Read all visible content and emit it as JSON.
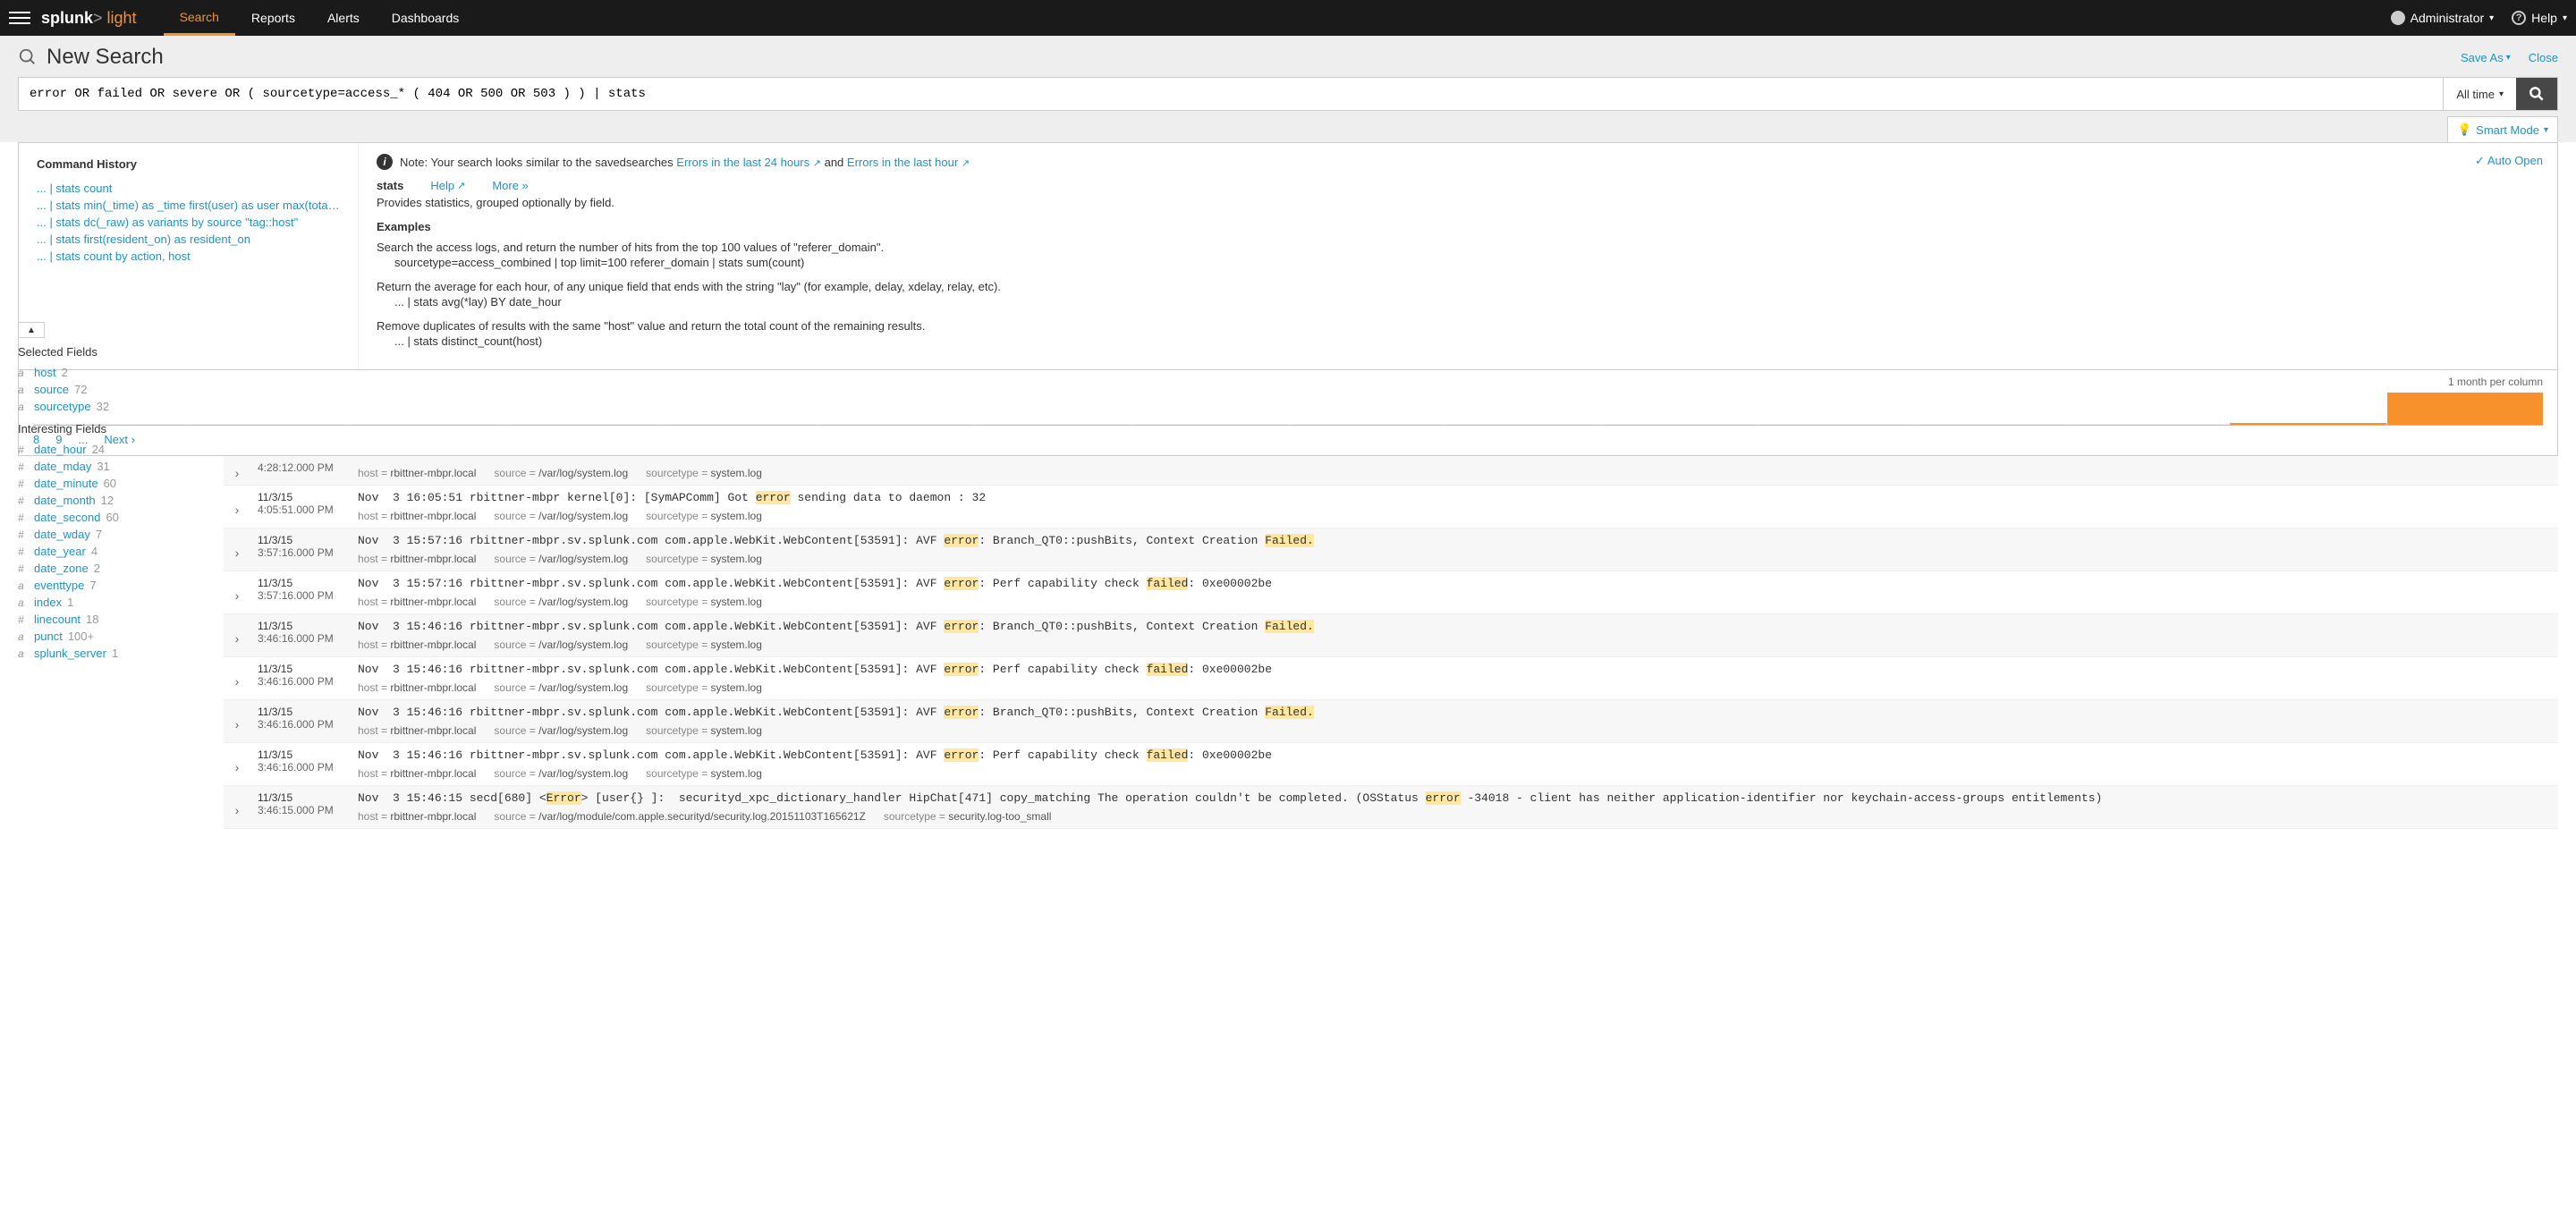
{
  "nav": {
    "brand_bold": "splunk",
    "brand_gt": ">",
    "brand_light": " light",
    "links": [
      "Search",
      "Reports",
      "Alerts",
      "Dashboards"
    ],
    "user": "Administrator",
    "help": "Help"
  },
  "search": {
    "title": "New Search",
    "save_as": "Save As",
    "close": "Close",
    "query": "error OR failed OR severe OR ( sourcetype=access_* ( 404 OR 500 OR 503 ) ) | stats",
    "time_range": "All time",
    "smart_mode": "Smart Mode"
  },
  "assist": {
    "history_title": "Command History",
    "history": [
      "... | stats count",
      "... | stats min(_time) as _time first(user) as user max(total_run_...",
      "... | stats dc(_raw) as variants by source \"tag::host\"",
      "... | stats first(resident_on) as resident_on",
      "... | stats count by action, host"
    ],
    "auto_open": "Auto Open",
    "hint_prefix": "Note: Your search looks similar to the savedsearches ",
    "hint_link1": "Errors in the last 24 hours",
    "hint_and": " and ",
    "hint_link2": "Errors in the last hour",
    "cmd": "stats",
    "help_link": "Help",
    "more_link": "More »",
    "desc": "Provides statistics, grouped optionally by field.",
    "examples_title": "Examples",
    "examples": [
      {
        "text": "Search the access logs, and return the number of hits from the top 100 values of \"referer_domain\".",
        "code": "sourcetype=access_combined | top limit=100 referer_domain | stats sum(count)"
      },
      {
        "text": "Return the average for each hour, of any unique field that ends with the string \"lay\" (for example, delay, xdelay, relay, etc).",
        "code": "... | stats avg(*lay) BY date_hour"
      },
      {
        "text": "Remove duplicates of results with the same \"host\" value and return the total count of the remaining results.",
        "code": "... | stats distinct_count(host)"
      }
    ]
  },
  "timeline": {
    "label": "1 month per column",
    "bars": [
      0,
      0,
      0,
      0,
      0,
      0,
      0,
      0,
      0,
      0,
      0,
      0,
      0,
      0,
      6,
      100
    ],
    "pager": [
      "8",
      "9",
      "...",
      "Next ›"
    ]
  },
  "fields": {
    "selected_title": "Selected Fields",
    "interesting_title": "Interesting Fields",
    "selected": [
      {
        "type": "a",
        "name": "host",
        "count": "2"
      },
      {
        "type": "a",
        "name": "source",
        "count": "72"
      },
      {
        "type": "a",
        "name": "sourcetype",
        "count": "32"
      }
    ],
    "interesting": [
      {
        "type": "#",
        "name": "date_hour",
        "count": "24"
      },
      {
        "type": "#",
        "name": "date_mday",
        "count": "31"
      },
      {
        "type": "#",
        "name": "date_minute",
        "count": "60"
      },
      {
        "type": "#",
        "name": "date_month",
        "count": "12"
      },
      {
        "type": "#",
        "name": "date_second",
        "count": "60"
      },
      {
        "type": "#",
        "name": "date_wday",
        "count": "7"
      },
      {
        "type": "#",
        "name": "date_year",
        "count": "4"
      },
      {
        "type": "#",
        "name": "date_zone",
        "count": "2"
      },
      {
        "type": "a",
        "name": "eventtype",
        "count": "7"
      },
      {
        "type": "a",
        "name": "index",
        "count": "1"
      },
      {
        "type": "#",
        "name": "linecount",
        "count": "18"
      },
      {
        "type": "a",
        "name": "punct",
        "count": "100+"
      },
      {
        "type": "a",
        "name": "splunk_server",
        "count": "1"
      }
    ]
  },
  "events": [
    {
      "date": "",
      "time": "4:28:12.000 PM",
      "raw": "",
      "host": "rbittner-mbpr.local",
      "source": "/var/log/system.log",
      "sourcetype": "system.log"
    },
    {
      "date": "11/3/15",
      "time": "4:05:51.000 PM",
      "raw_pre": "Nov  3 16:05:51 rbittner-mbpr kernel[0]: [SymAPComm] Got ",
      "raw_hl": "error",
      "raw_post": " sending data to daemon : 32",
      "host": "rbittner-mbpr.local",
      "source": "/var/log/system.log",
      "sourcetype": "system.log"
    },
    {
      "date": "11/3/15",
      "time": "3:57:16.000 PM",
      "raw_pre": "Nov  3 15:57:16 rbittner-mbpr.sv.splunk.com com.apple.WebKit.WebContent[53591]: AVF ",
      "raw_hl": "error",
      "raw_mid": ": Branch_QT0::pushBits, Context Creation ",
      "raw_hl2": "Failed.",
      "host": "rbittner-mbpr.local",
      "source": "/var/log/system.log",
      "sourcetype": "system.log"
    },
    {
      "date": "11/3/15",
      "time": "3:57:16.000 PM",
      "raw_pre": "Nov  3 15:57:16 rbittner-mbpr.sv.splunk.com com.apple.WebKit.WebContent[53591]: AVF ",
      "raw_hl": "error",
      "raw_mid": ": Perf capability check ",
      "raw_hl2": "failed",
      "raw_post": ": 0xe00002be",
      "host": "rbittner-mbpr.local",
      "source": "/var/log/system.log",
      "sourcetype": "system.log"
    },
    {
      "date": "11/3/15",
      "time": "3:46:16.000 PM",
      "raw_pre": "Nov  3 15:46:16 rbittner-mbpr.sv.splunk.com com.apple.WebKit.WebContent[53591]: AVF ",
      "raw_hl": "error",
      "raw_mid": ": Branch_QT0::pushBits, Context Creation ",
      "raw_hl2": "Failed.",
      "host": "rbittner-mbpr.local",
      "source": "/var/log/system.log",
      "sourcetype": "system.log"
    },
    {
      "date": "11/3/15",
      "time": "3:46:16.000 PM",
      "raw_pre": "Nov  3 15:46:16 rbittner-mbpr.sv.splunk.com com.apple.WebKit.WebContent[53591]: AVF ",
      "raw_hl": "error",
      "raw_mid": ": Perf capability check ",
      "raw_hl2": "failed",
      "raw_post": ": 0xe00002be",
      "host": "rbittner-mbpr.local",
      "source": "/var/log/system.log",
      "sourcetype": "system.log"
    },
    {
      "date": "11/3/15",
      "time": "3:46:16.000 PM",
      "raw_pre": "Nov  3 15:46:16 rbittner-mbpr.sv.splunk.com com.apple.WebKit.WebContent[53591]: AVF ",
      "raw_hl": "error",
      "raw_mid": ": Branch_QT0::pushBits, Context Creation ",
      "raw_hl2": "Failed.",
      "host": "rbittner-mbpr.local",
      "source": "/var/log/system.log",
      "sourcetype": "system.log"
    },
    {
      "date": "11/3/15",
      "time": "3:46:16.000 PM",
      "raw_pre": "Nov  3 15:46:16 rbittner-mbpr.sv.splunk.com com.apple.WebKit.WebContent[53591]: AVF ",
      "raw_hl": "error",
      "raw_mid": ": Perf capability check ",
      "raw_hl2": "failed",
      "raw_post": ": 0xe00002be",
      "host": "rbittner-mbpr.local",
      "source": "/var/log/system.log",
      "sourcetype": "system.log"
    },
    {
      "date": "11/3/15",
      "time": "3:46:15.000 PM",
      "raw_pre": "Nov  3 15:46:15 secd[680] <",
      "raw_hl": "Error",
      "raw_mid": "> [user{} ]:  securityd_xpc_dictionary_handler HipChat[471] copy_matching The operation couldn't be completed. (OSStatus ",
      "raw_hl2": "error",
      "raw_post": " -34018 - client has neither application-identifier nor keychain-access-groups entitlements)",
      "host": "rbittner-mbpr.local",
      "source": "/var/log/module/com.apple.securityd/security.log.20151103T165621Z",
      "sourcetype": "security.log-too_small"
    }
  ],
  "meta_labels": {
    "host": "host = ",
    "source": "source = ",
    "sourcetype": "sourcetype = "
  }
}
